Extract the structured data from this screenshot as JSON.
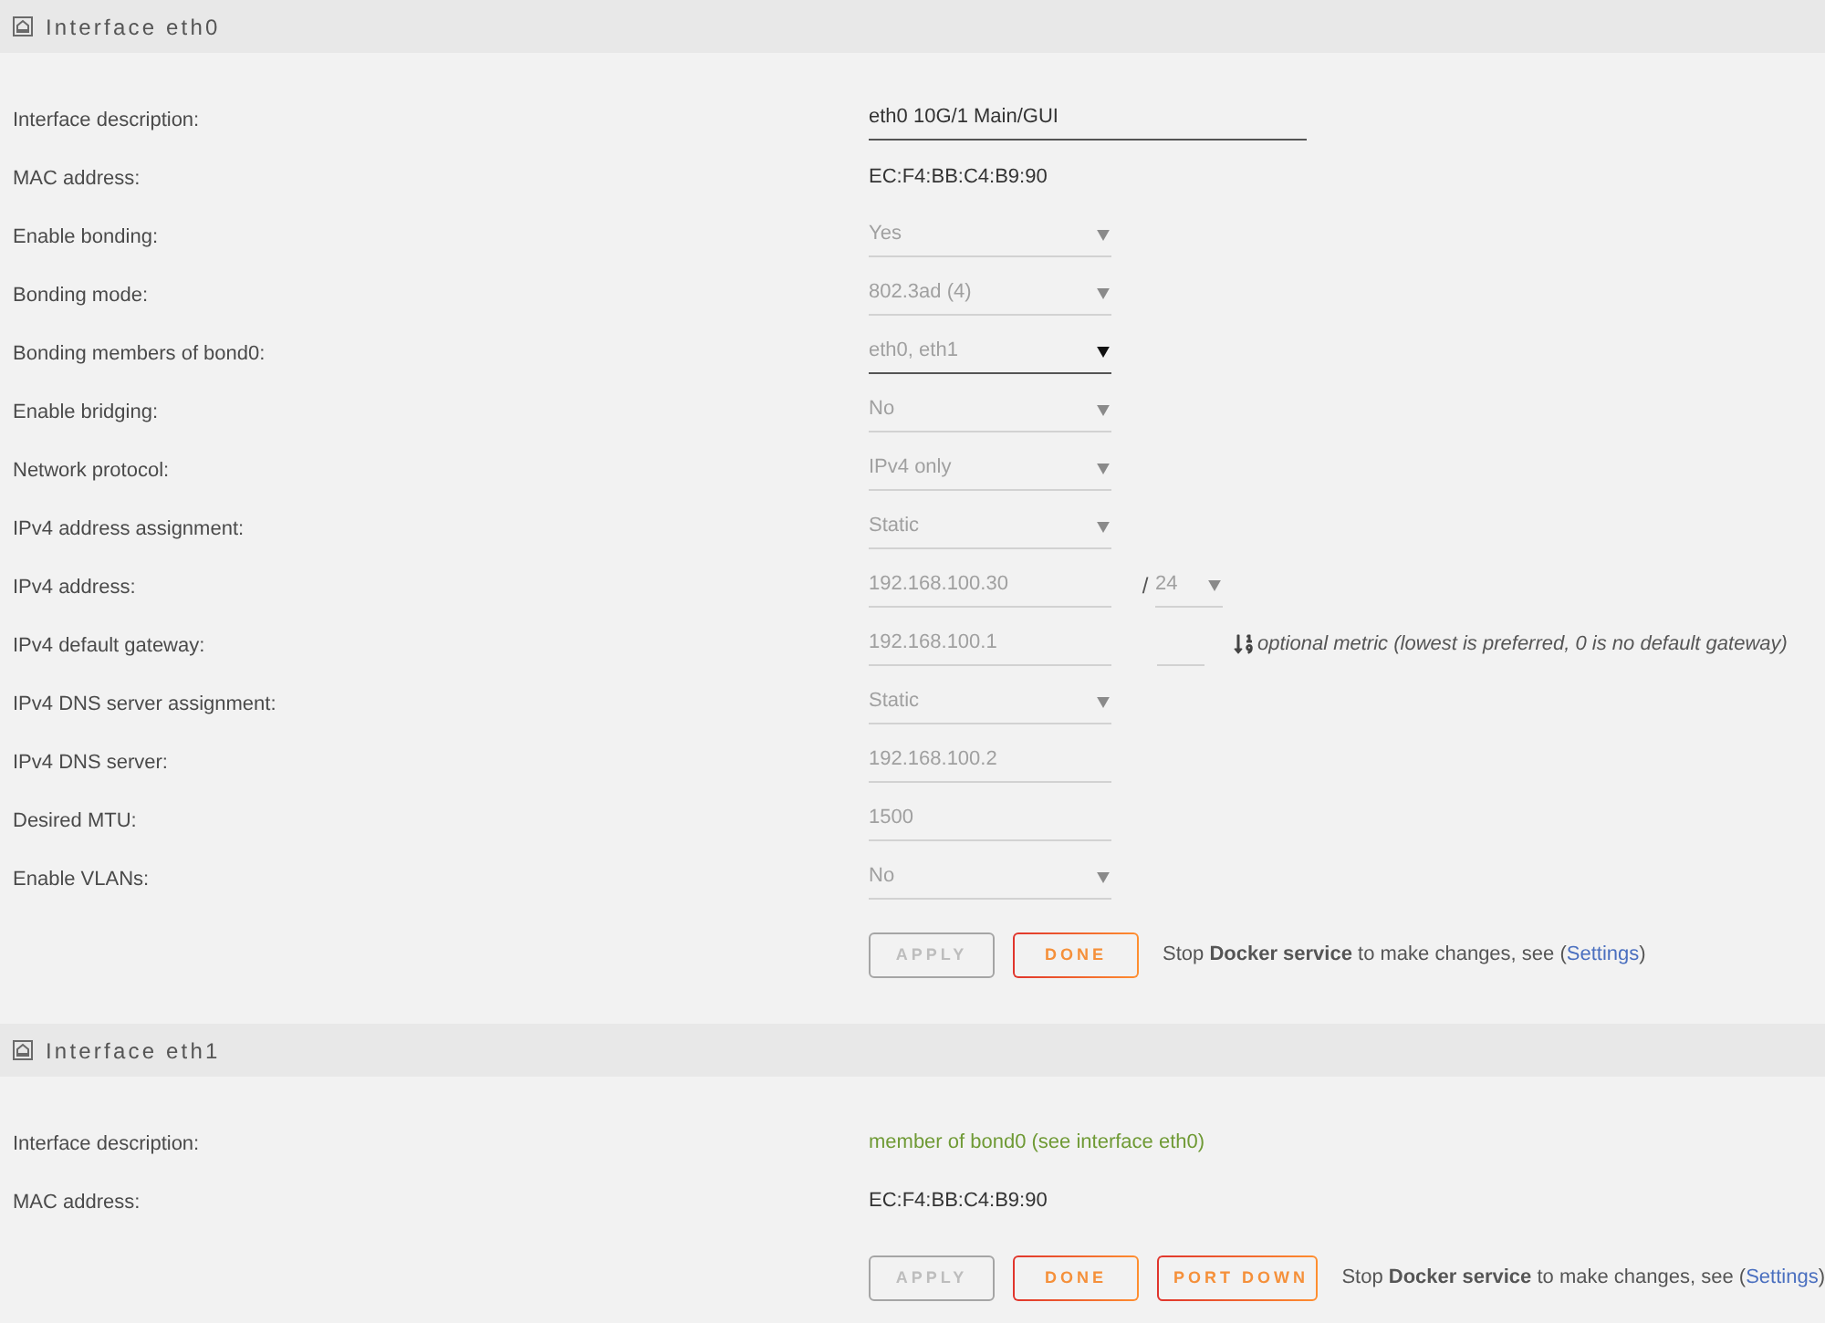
{
  "sections": [
    {
      "title": "Interface eth0",
      "rows": [
        {
          "label": "Interface description:",
          "field": {
            "kind": "text_field",
            "value": "eth0 10G/1 Main/GUI",
            "disabled": false
          }
        },
        {
          "label": "MAC address:",
          "field": {
            "kind": "static",
            "value": "EC:F4:BB:C4:B9:90"
          }
        },
        {
          "label": "Enable bonding:",
          "field": {
            "kind": "select",
            "value": "Yes",
            "disabled": true
          }
        },
        {
          "label": "Bonding mode:",
          "field": {
            "kind": "select",
            "value": "802.3ad (4)",
            "disabled": true
          }
        },
        {
          "label": "Bonding members of bond0:",
          "field": {
            "kind": "select",
            "value": "eth0, eth1",
            "disabled": false
          }
        },
        {
          "label": "Enable bridging:",
          "field": {
            "kind": "select",
            "value": "No",
            "disabled": true
          }
        },
        {
          "label": "Network protocol:",
          "field": {
            "kind": "select",
            "value": "IPv4 only",
            "disabled": true
          }
        },
        {
          "label": "IPv4 address assignment:",
          "field": {
            "kind": "select",
            "value": "Static",
            "disabled": true
          }
        },
        {
          "label": "IPv4 address:",
          "field": {
            "kind": "input",
            "value": "192.168.100.30",
            "disabled": true
          },
          "extras": [
            {
              "kind": "separator",
              "text": "/"
            },
            {
              "kind": "select",
              "value": "24",
              "disabled": true
            }
          ]
        },
        {
          "label": "IPv4 default gateway:",
          "field": {
            "kind": "input",
            "value": "192.168.100.1",
            "disabled": true
          },
          "extras": [
            {
              "kind": "input",
              "disabled": true
            },
            {
              "kind": "hint",
              "text": "optional metric (lowest is preferred, 0 is no default gateway)"
            }
          ]
        },
        {
          "label": "IPv4 DNS server assignment:",
          "field": {
            "kind": "select",
            "value": "Static",
            "disabled": true
          }
        },
        {
          "label": "IPv4 DNS server:",
          "field": {
            "kind": "input",
            "value": "192.168.100.2",
            "disabled": true
          }
        },
        {
          "label": "Desired MTU:",
          "field": {
            "kind": "input",
            "value": "1500",
            "disabled": true
          }
        },
        {
          "label": "Enable VLANs:",
          "field": {
            "kind": "select",
            "value": "No",
            "disabled": true
          }
        }
      ],
      "buttons": [
        {
          "label": "APPLY",
          "disabled": true
        },
        {
          "label": "DONE",
          "disabled": false
        }
      ],
      "note": {
        "text": "Stop **Docker service** to make changes, see (",
        "link": "Settings",
        "after": ")"
      }
    },
    {
      "title": "Interface eth1",
      "rows": [
        {
          "label": "Interface description:",
          "field": {
            "kind": "status",
            "value": "member of bond0 (see interface eth0)"
          }
        },
        {
          "label": "MAC address:",
          "field": {
            "kind": "static",
            "value": "EC:F4:BB:C4:B9:90"
          }
        }
      ],
      "buttons": [
        {
          "label": "APPLY",
          "disabled": true
        },
        {
          "label": "DONE",
          "disabled": false
        },
        {
          "label": "PORT DOWN",
          "disabled": false
        }
      ],
      "note": {
        "text": "Stop **Docker service** to make changes, see (",
        "link": "Settings",
        "after": ")"
      }
    }
  ]
}
